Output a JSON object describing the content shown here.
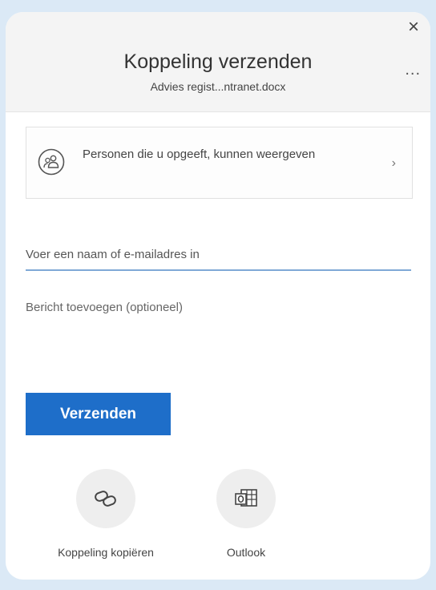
{
  "header": {
    "title": "Koppeling verzenden",
    "subtitle": "Advies regist...ntranet.docx",
    "close_symbol": "×",
    "more_symbol": "..."
  },
  "permissions": {
    "text": "Personen die u opgeeft, kunnen weergeven",
    "icon": "people-icon",
    "chevron": "›"
  },
  "recipients": {
    "placeholder": "Voer een naam of e-mailadres in",
    "value": ""
  },
  "message": {
    "placeholder": "Bericht toevoegen (optioneel)",
    "value": ""
  },
  "send_button": {
    "label": "Verzenden",
    "color": "#1e6ec9"
  },
  "actions": [
    {
      "label": "Koppeling kopiëren",
      "icon": "link-icon"
    },
    {
      "label": "Outlook",
      "icon": "outlook-icon"
    }
  ]
}
